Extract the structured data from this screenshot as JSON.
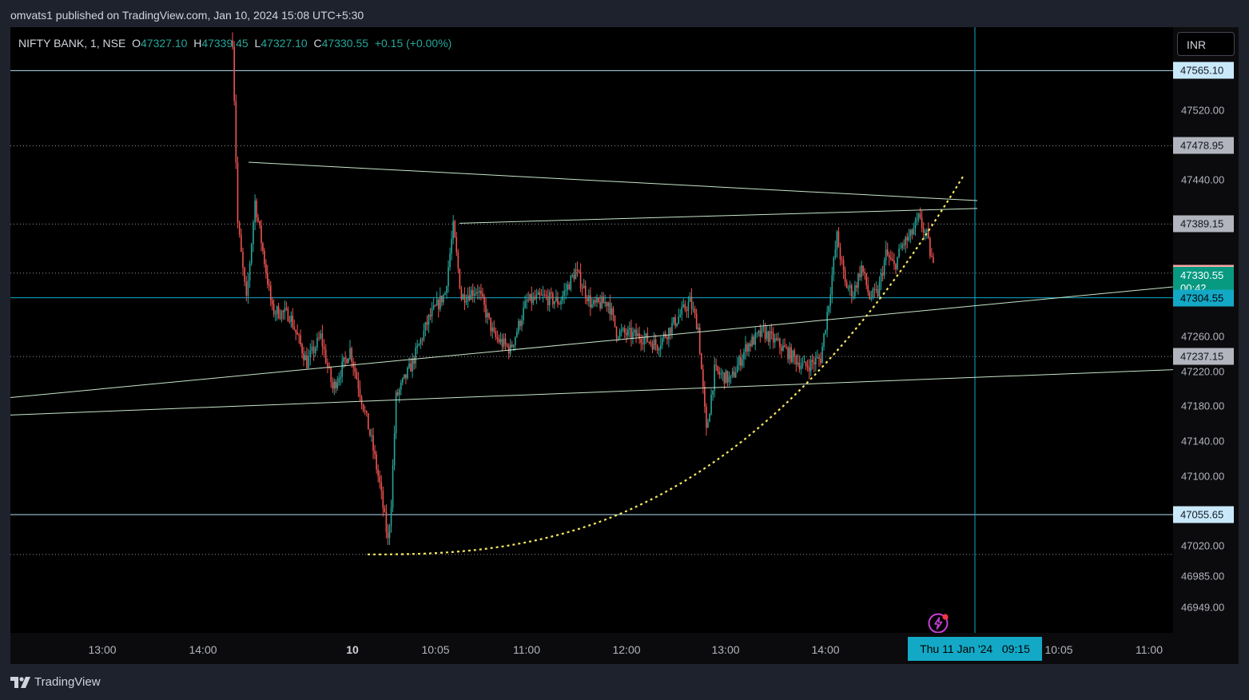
{
  "header": {
    "published_text": "omvats1 published on TradingView.com, Jan 10, 2024 15:08 UTC+5:30"
  },
  "legend": {
    "symbol": "NIFTY BANK, 1, NSE",
    "o_label": "O",
    "o_value": "47327.10",
    "h_label": "H",
    "h_value": "47339.45",
    "l_label": "L",
    "l_value": "47327.10",
    "c_label": "C",
    "c_value": "47330.55",
    "change": "+0.15 (+0.00%)"
  },
  "currency_button": "INR",
  "footer": {
    "brand": "TradingView"
  },
  "colors": {
    "up": "#26a69a",
    "down": "#ef5350",
    "trendline": "#c8e6c9",
    "curve": "#f5e663",
    "crosshair": "#13a9c6",
    "level": "#b3dff5"
  },
  "icons": {
    "alert": "lightning-alert-icon",
    "logo": "tradingview-logo-icon"
  },
  "chart_data": {
    "type": "candlestick",
    "symbol": "NIFTY BANK",
    "interval": "1",
    "exchange": "NSE",
    "ylim": [
      46920,
      47615
    ],
    "price_ticks": [
      "47520.00",
      "47440.00",
      "47260.00",
      "47220.00",
      "47180.00",
      "47140.00",
      "47100.00",
      "47020.00",
      "46985.00",
      "46949.00"
    ],
    "price_tick_values": [
      47520,
      47440,
      47260,
      47220,
      47180,
      47140,
      47100,
      47020,
      46985,
      46949
    ],
    "price_labels": [
      {
        "text": "47565.10",
        "value": 47565.1,
        "style": "level"
      },
      {
        "text": "47478.95",
        "value": 47478.95,
        "style": "gray"
      },
      {
        "text": "47389.15",
        "value": 47389.15,
        "style": "gray"
      },
      {
        "text": "47332.85",
        "value": 47332.85,
        "style": "red"
      },
      {
        "text": "47330.55",
        "sub": "00:42",
        "value": 47330.55,
        "style": "green"
      },
      {
        "text": "47304.55",
        "value": 47304.55,
        "style": "cyan"
      },
      {
        "text": "47237.15",
        "value": 47237.15,
        "style": "gray"
      },
      {
        "text": "47055.65",
        "value": 47055.65,
        "style": "level"
      }
    ],
    "horizontal_levels": [
      {
        "value": 47565.1,
        "style": "solid"
      },
      {
        "value": 47478.95,
        "style": "dotted"
      },
      {
        "value": 47389.15,
        "style": "dotted"
      },
      {
        "value": 47332.85,
        "style": "dotted"
      },
      {
        "value": 47304.55,
        "style": "crosshair"
      },
      {
        "value": 47237.15,
        "style": "dotted"
      },
      {
        "value": 47055.65,
        "style": "solid"
      },
      {
        "value": 47010.0,
        "style": "dotted"
      }
    ],
    "time_ticks": [
      {
        "label": "13:00",
        "bold": false
      },
      {
        "label": "14:00",
        "bold": false
      },
      {
        "label": "10",
        "bold": true
      },
      {
        "label": "10:05",
        "bold": false
      },
      {
        "label": "11:00",
        "bold": false
      },
      {
        "label": "12:00",
        "bold": false
      },
      {
        "label": "13:00",
        "bold": false
      },
      {
        "label": "14:00",
        "bold": false
      },
      {
        "label": "10:05",
        "bold": false
      },
      {
        "label": "11:00",
        "bold": false
      }
    ],
    "crosshair_time": "Thu 11 Jan '24   09:15",
    "price_path": [
      {
        "t": "14:17",
        "p": 47600
      },
      {
        "t": "14:18",
        "p": 47535
      },
      {
        "t": "14:20",
        "p": 47390
      },
      {
        "t": "14:25",
        "p": 47300
      },
      {
        "t": "14:30",
        "p": 47415
      },
      {
        "t": "14:40",
        "p": 47290
      },
      {
        "t": "14:50",
        "p": 47285
      },
      {
        "t": "15:00",
        "p": 47230
      },
      {
        "t": "15:08",
        "p": 47260
      },
      {
        "t": "15:15",
        "p": 47200
      },
      {
        "t": "15:25",
        "p": 47245
      },
      {
        "t": "09:15",
        "p": 47140
      },
      {
        "t": "09:20",
        "p": 47090
      },
      {
        "t": "09:25",
        "p": 47025
      },
      {
        "t": "09:27",
        "p": 47070
      },
      {
        "t": "09:30",
        "p": 47190
      },
      {
        "t": "09:40",
        "p": 47230
      },
      {
        "t": "09:50",
        "p": 47280
      },
      {
        "t": "10:00",
        "p": 47310
      },
      {
        "t": "10:05",
        "p": 47385
      },
      {
        "t": "10:10",
        "p": 47305
      },
      {
        "t": "10:20",
        "p": 47315
      },
      {
        "t": "10:30",
        "p": 47260
      },
      {
        "t": "10:40",
        "p": 47245
      },
      {
        "t": "10:50",
        "p": 47300
      },
      {
        "t": "11:00",
        "p": 47305
      },
      {
        "t": "11:10",
        "p": 47300
      },
      {
        "t": "11:20",
        "p": 47335
      },
      {
        "t": "11:30",
        "p": 47295
      },
      {
        "t": "11:40",
        "p": 47300
      },
      {
        "t": "11:45",
        "p": 47265
      },
      {
        "t": "12:00",
        "p": 47260
      },
      {
        "t": "12:10",
        "p": 47250
      },
      {
        "t": "12:20",
        "p": 47275
      },
      {
        "t": "12:30",
        "p": 47300
      },
      {
        "t": "12:35",
        "p": 47270
      },
      {
        "t": "12:40",
        "p": 47150
      },
      {
        "t": "12:45",
        "p": 47220
      },
      {
        "t": "12:55",
        "p": 47210
      },
      {
        "t": "13:05",
        "p": 47250
      },
      {
        "t": "13:15",
        "p": 47265
      },
      {
        "t": "13:25",
        "p": 47250
      },
      {
        "t": "13:40",
        "p": 47225
      },
      {
        "t": "13:50",
        "p": 47235
      },
      {
        "t": "13:55",
        "p": 47300
      },
      {
        "t": "14:00",
        "p": 47375
      },
      {
        "t": "14:05",
        "p": 47320
      },
      {
        "t": "14:10",
        "p": 47310
      },
      {
        "t": "14:15",
        "p": 47340
      },
      {
        "t": "14:20",
        "p": 47305
      },
      {
        "t": "14:25",
        "p": 47310
      },
      {
        "t": "14:30",
        "p": 47355
      },
      {
        "t": "14:35",
        "p": 47340
      },
      {
        "t": "14:40",
        "p": 47365
      },
      {
        "t": "14:45",
        "p": 47375
      },
      {
        "t": "14:50",
        "p": 47395
      },
      {
        "t": "14:55",
        "p": 47375
      },
      {
        "t": "15:00",
        "p": 47330
      }
    ]
  }
}
